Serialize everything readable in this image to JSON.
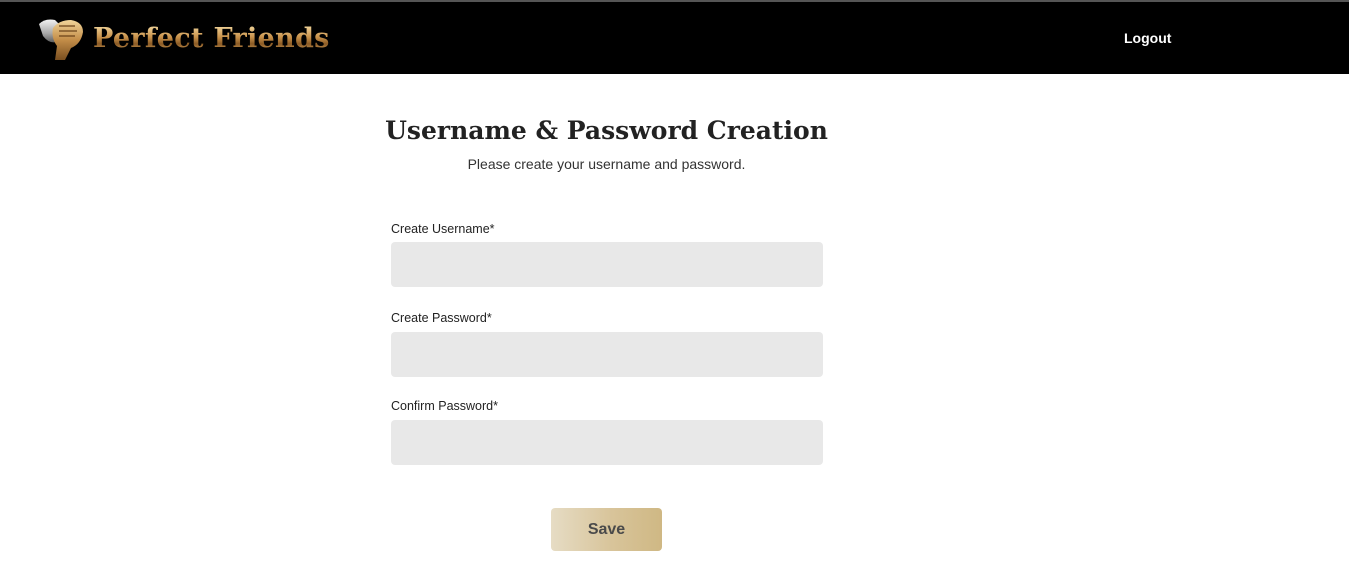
{
  "header": {
    "brand_name": "Perfect Friends",
    "logo_icon": "fist-bump-icon",
    "logout_label": "Logout"
  },
  "form": {
    "title": "Username & Password Creation",
    "subtitle": "Please create your username and password.",
    "username": {
      "label": "Create Username*",
      "value": "",
      "placeholder": ""
    },
    "password": {
      "label": "Create Password*",
      "value": "",
      "placeholder": ""
    },
    "confirm_password": {
      "label": "Confirm Password*",
      "value": "",
      "placeholder": ""
    },
    "save_label": "Save"
  },
  "colors": {
    "header_bg": "#000000",
    "input_bg": "#e8e8e8",
    "button_gold": "#d8c49a",
    "brand_gold": "#c89a55"
  }
}
